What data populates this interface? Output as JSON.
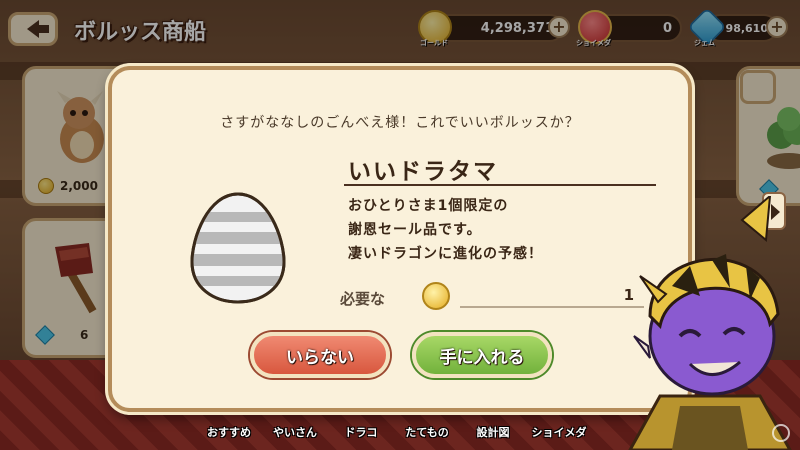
{
  "header": {
    "title": "ボルッス商船"
  },
  "currencies": {
    "gold": {
      "label": "ゴールド",
      "value": "4,298,371"
    },
    "shoimeda": {
      "label": "ショイメダ",
      "value": "0"
    },
    "gem": {
      "label": "ジェム",
      "value": "98,610"
    },
    "plus_label": "+"
  },
  "background_items": {
    "dragon_price": "2,000",
    "axe_price": "6"
  },
  "dialog": {
    "prompt": "さすがななしのごんべえ様！これでいいボルッスか？",
    "item_name": "いいドラタマ",
    "desc_line1": "おひとりさま1個限定の",
    "desc_line2": "謝恩セール品です。",
    "desc_line3": "凄いドラゴンに進化の予感！",
    "required_label": "必要な",
    "required_value": "1",
    "cancel_label": "いらない",
    "confirm_label": "手に入れる"
  },
  "tabs": [
    "おすすめ",
    "やいさん",
    "ドラコ",
    "たてもの",
    "設計図",
    "ショイメダ"
  ],
  "colors": {
    "dialog_bg": "#faf1db",
    "cancel_button": "#d8573e",
    "confirm_button": "#72b23c",
    "gold_coin": "#e4ac20",
    "gem": "#4ec6e8",
    "medal": "#d83a3a"
  },
  "icons": {
    "back": "left-arrow-icon",
    "gold": "gold-coin-icon",
    "medal": "shoimeda-medal-icon",
    "gem": "gem-icon",
    "egg": "striped-egg-icon"
  }
}
